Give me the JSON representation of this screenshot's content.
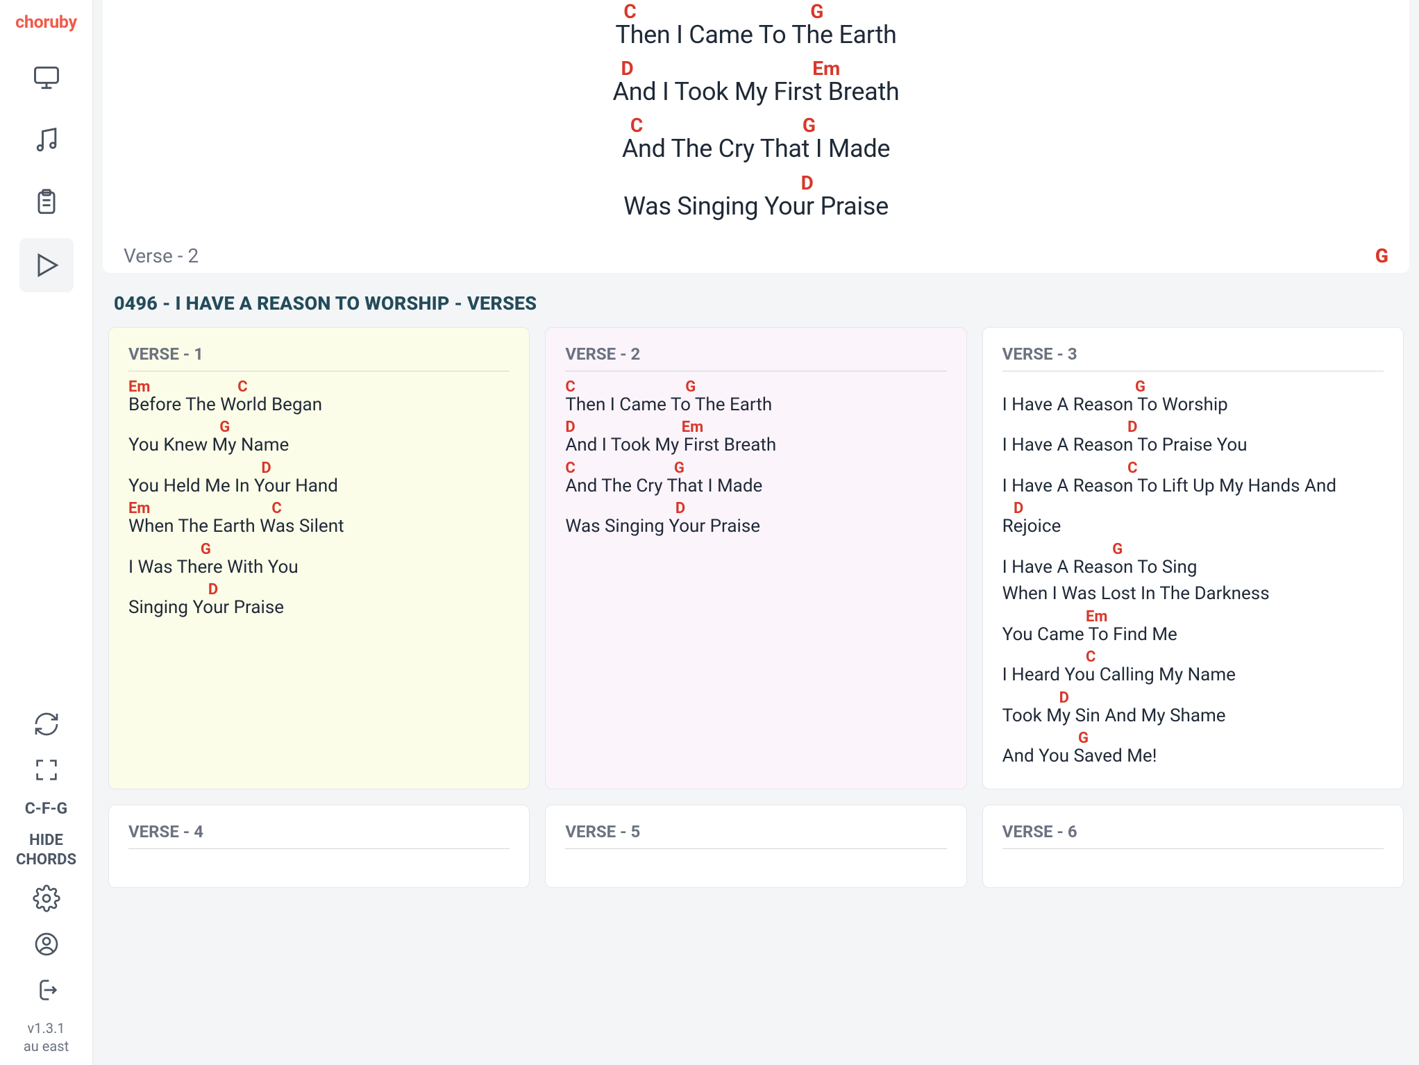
{
  "app": {
    "logo": "choruby",
    "version": "v1.3.1",
    "region": "au east"
  },
  "sidebar": {
    "chord_shortcut": "C-F-G",
    "hide_chords": "HIDE CHORDS"
  },
  "preview": {
    "lines": [
      {
        "chords": "C                                    G",
        "lyric": "Then I Came To The Earth"
      },
      {
        "chords": "D                                     Em",
        "lyric": "And I Took My First Breath"
      },
      {
        "chords": "C                                 G",
        "lyric": "And The Cry That I Made"
      },
      {
        "chords": "                                   D",
        "lyric": "Was Singing Your Praise"
      }
    ],
    "footer_left": "Verse - 2",
    "footer_right": "G"
  },
  "section_title": "0496 - I HAVE A REASON TO WORSHIP - VERSES",
  "cards": [
    {
      "title": "VERSE - 1",
      "variant": "v1",
      "lines": [
        {
          "chords": "Em                       C",
          "lyric": "Before The World Began"
        },
        {
          "chords": "                        G",
          "lyric": "You Knew My Name"
        },
        {
          "chords": "                                   D",
          "lyric": "You Held Me In Your Hand"
        },
        {
          "chords": "Em                                C",
          "lyric": "When The Earth Was Silent"
        },
        {
          "chords": "                   G",
          "lyric": "I Was There With You"
        },
        {
          "chords": "                     D",
          "lyric": "Singing Your Praise"
        }
      ]
    },
    {
      "title": "VERSE - 2",
      "variant": "v2",
      "lines": [
        {
          "chords": "C                             G",
          "lyric": "Then I Came To The Earth"
        },
        {
          "chords": "D                            Em",
          "lyric": "And I Took My First Breath"
        },
        {
          "chords": "C                          G",
          "lyric": "And The Cry That I Made"
        },
        {
          "chords": "                             D",
          "lyric": "Was Singing Your Praise"
        }
      ]
    },
    {
      "title": "VERSE - 3",
      "variant": "",
      "lines": [
        {
          "chords": "                                   G",
          "lyric": "I Have A Reason To Worship"
        },
        {
          "chords": "                                 D",
          "lyric": "I Have A Reason To Praise You"
        },
        {
          "chords": "                                 C",
          "lyric": "I Have A Reason To Lift Up My Hands And"
        },
        {
          "chords": "   D",
          "lyric": "Rejoice"
        },
        {
          "chords": "                             G",
          "lyric": "I Have A Reason To Sing"
        },
        {
          "chords": "",
          "lyric": "When I Was Lost In The Darkness"
        },
        {
          "chords": "                      Em",
          "lyric": "You Came To Find Me"
        },
        {
          "chords": "                      C",
          "lyric": "I Heard You Calling My Name"
        },
        {
          "chords": "               D",
          "lyric": "Took My Sin And My Shame"
        },
        {
          "chords": "                    G",
          "lyric": "And You Saved Me!"
        }
      ]
    },
    {
      "title": "VERSE - 4",
      "variant": "",
      "lines": []
    },
    {
      "title": "VERSE - 5",
      "variant": "",
      "lines": []
    },
    {
      "title": "VERSE - 6",
      "variant": "",
      "lines": []
    }
  ]
}
